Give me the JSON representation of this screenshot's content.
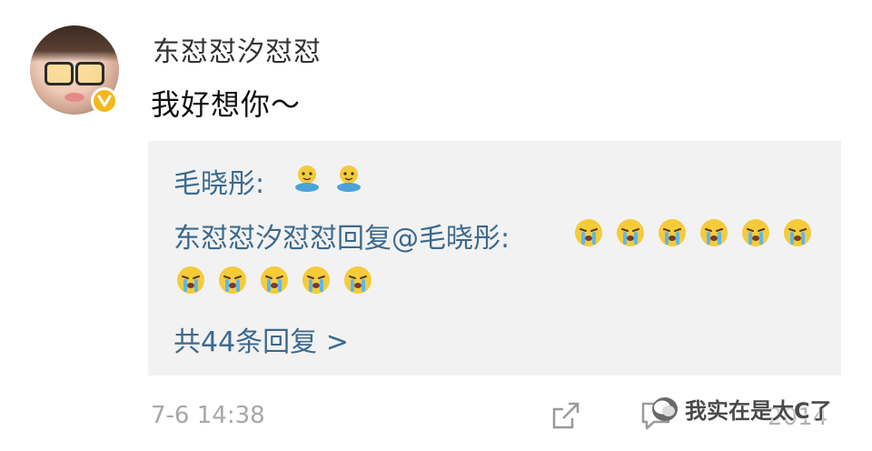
{
  "post": {
    "author": "东怼怼汐怼怼",
    "text": "我好想你～",
    "timestamp": "7-6 14:38"
  },
  "replies": {
    "line1_name": "毛晓彤:",
    "line2_text": "东怼怼汐怼怼回复@毛晓彤:",
    "more_label": "共44条回复 >"
  },
  "actions": {
    "like_count": "2014"
  },
  "watermark": {
    "text": "我实在是太C了"
  },
  "icons": {
    "verified": "verified-badge-icon",
    "share": "share-icon",
    "comment": "comment-icon",
    "emoji_hug": "hug-emoji-icon",
    "emoji_cry": "crying-emoji-icon"
  },
  "colors": {
    "link": "#3d6a8e",
    "reply_bg": "#f2f2f2",
    "muted": "#a8a8a8",
    "verified": "#f2b81c"
  }
}
